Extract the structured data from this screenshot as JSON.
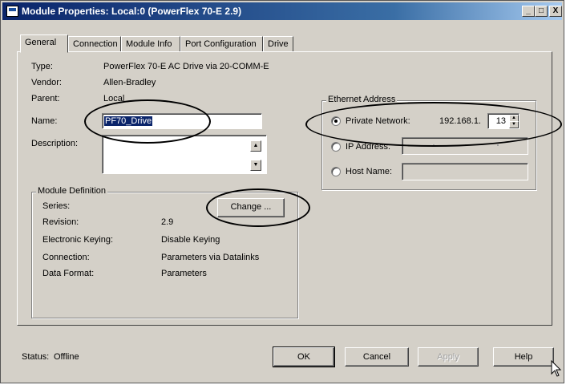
{
  "window": {
    "title": "Module Properties: Local:0 (PowerFlex 70-E 2.9)",
    "controls": {
      "minimize": "_",
      "maximize": "□",
      "close": "X"
    }
  },
  "tabs": [
    {
      "label": "General",
      "active": true
    },
    {
      "label": "Connection",
      "active": false
    },
    {
      "label": "Module Info",
      "active": false
    },
    {
      "label": "Port Configuration",
      "active": false
    },
    {
      "label": "Drive",
      "active": false
    }
  ],
  "general": {
    "type_label": "Type:",
    "type_value": "PowerFlex 70-E AC Drive via 20-COMM-E",
    "vendor_label": "Vendor:",
    "vendor_value": "Allen-Bradley",
    "parent_label": "Parent:",
    "parent_value": "Local",
    "name_label": "Name:",
    "name_value": "PF70_Drive",
    "description_label": "Description:",
    "description_value": ""
  },
  "module_definition": {
    "title": "Module Definition",
    "series_label": "Series:",
    "change_button": "Change ...",
    "revision_label": "Revision:",
    "revision_value": "2.9",
    "keying_label": "Electronic Keying:",
    "keying_value": "Disable Keying",
    "connection_label": "Connection:",
    "connection_value": "Parameters via Datalinks",
    "data_format_label": "Data Format:",
    "data_format_value": "Parameters"
  },
  "ethernet": {
    "title": "Ethernet Address",
    "private_label": "Private Network:",
    "private_prefix": "192.168.1.",
    "private_last_octet": "13",
    "ip_label": "IP Address:",
    "host_label": "Host Name:",
    "selected": "private"
  },
  "footer": {
    "status_label": "Status:",
    "status_value": "Offline",
    "ok": "OK",
    "cancel": "Cancel",
    "apply": "Apply",
    "help": "Help"
  },
  "icons": {
    "app": "module-properties-icon",
    "spin_up": "▲",
    "spin_down": "▼",
    "scroll_up": "▲",
    "scroll_down": "▼"
  },
  "colors": {
    "titlebar_start": "#0a246a",
    "titlebar_end": "#a6caf0",
    "dialog_face": "#d4d0c8",
    "selection": "#0a246a",
    "annotation": "#000000"
  }
}
